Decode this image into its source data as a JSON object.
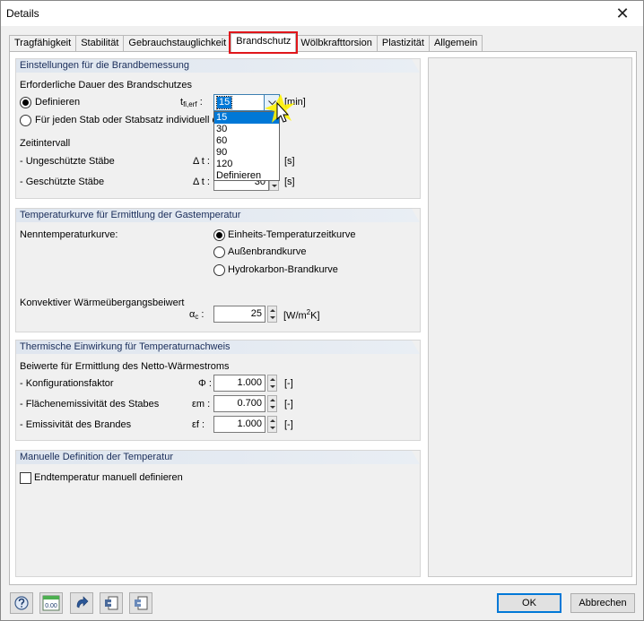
{
  "window": {
    "title": "Details",
    "close_glyph": "✕"
  },
  "tabs": [
    {
      "label": "Tragfähigkeit"
    },
    {
      "label": "Stabilität"
    },
    {
      "label": "Gebrauchstauglichkeit"
    },
    {
      "label": "Brandschutz",
      "active": true
    },
    {
      "label": "Wölbkrafttorsion"
    },
    {
      "label": "Plastizität"
    },
    {
      "label": "Allgemein"
    }
  ],
  "fire_settings": {
    "header": "Einstellungen für die Brandbemessung",
    "duration_label": "Erforderliche Dauer des Brandschutzes",
    "radio_define": "Definieren",
    "radio_individual": "Für jeden Stab oder Stabsatz individuell d",
    "symbol_main": "t",
    "symbol_sub": "fi,erf",
    "symbol_colon": ":",
    "combo_value": "15",
    "unit": "[min]",
    "options": [
      "15",
      "30",
      "60",
      "90",
      "120",
      "Definieren"
    ],
    "interval_label": "Zeitintervall",
    "unprotected_label": "- Ungeschützte Stäbe",
    "protected_label": "- Geschützte Stäbe",
    "delta_t": "Δ t :",
    "protected_value": "30",
    "interval_unit": "[s]"
  },
  "temp_curve": {
    "header": "Temperaturkurve für Ermittlung der Gastemperatur",
    "nominal_label": "Nenntemperaturkurve:",
    "curves": [
      "Einheits-Temperaturzeitkurve",
      "Außenbrandkurve",
      "Hydrokarbon-Brandkurve"
    ],
    "selected_curve": "Einheits-Temperaturzeitkurve",
    "convective_label": "Konvektiver Wärmeübergangsbeiwert",
    "alpha_symbol": "α",
    "alpha_sub": "c",
    "alpha_colon": ":",
    "alpha_value": "25",
    "alpha_unit_pre": "[W/m",
    "alpha_unit_sup": "2",
    "alpha_unit_post": "K]"
  },
  "thermal": {
    "header": "Thermische Einwirkung für Temperaturnachweis",
    "coeffs_label": "Beiwerte für Ermittlung des Netto-Wärmestroms",
    "rows": [
      {
        "label": "- Konfigurationsfaktor",
        "symbol": "Φ :",
        "value": "1.000",
        "unit": "[-]"
      },
      {
        "label": "- Flächenemissivität des Stabes",
        "symbol": "εm :",
        "value": "0.700",
        "unit": "[-]"
      },
      {
        "label": "- Emissivität des Brandes",
        "symbol": "εf :",
        "value": "1.000",
        "unit": "[-]"
      }
    ]
  },
  "manual": {
    "header": "Manuelle Definition der Temperatur",
    "checkbox_label": "Endtemperatur manuell definieren"
  },
  "footer": {
    "ok": "OK",
    "cancel": "Abbrechen",
    "units_icon_text": "0.00"
  }
}
